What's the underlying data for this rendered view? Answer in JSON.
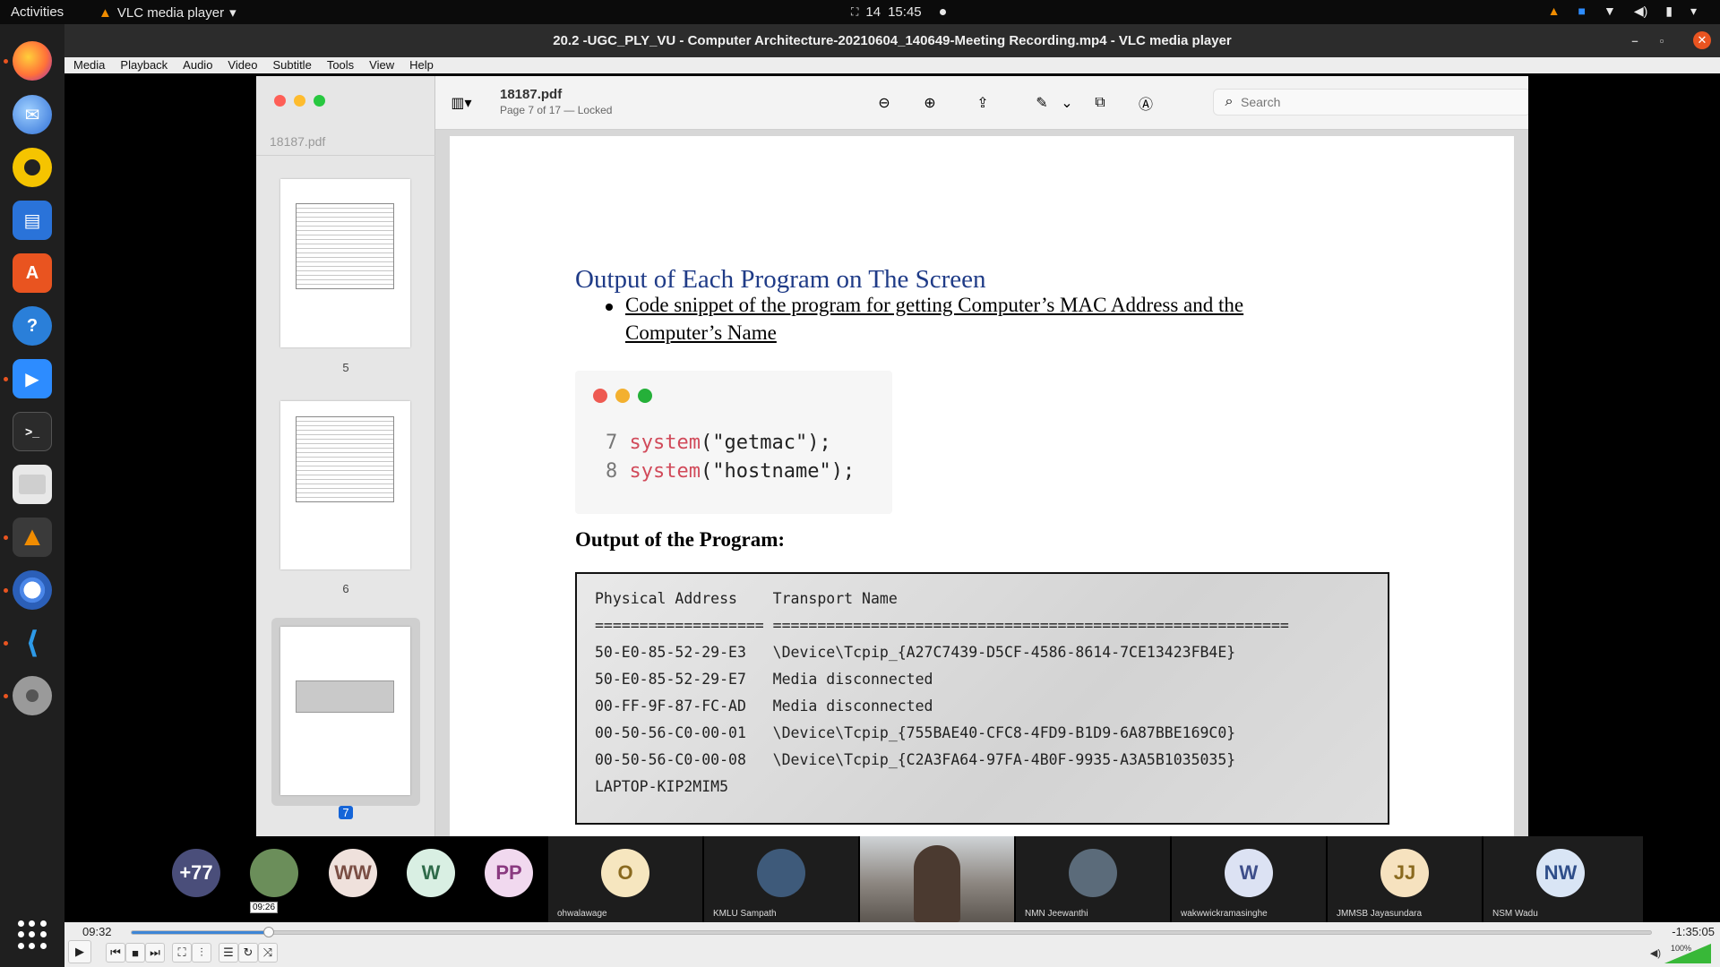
{
  "topbar": {
    "activities": "Activities",
    "app_name": "VLC media player",
    "date": "14",
    "time": "15:45"
  },
  "vlc": {
    "window_title": "20.2 -UGC_PLY_VU - Computer Architecture-20210604_140649-Meeting Recording.mp4 - VLC media player",
    "menu": [
      "Media",
      "Playback",
      "Audio",
      "Video",
      "Subtitle",
      "Tools",
      "View",
      "Help"
    ],
    "time_elapsed": "09:32",
    "time_remaining": "-1:35:05",
    "hover_time": "09:26",
    "progress": 0.09,
    "volume_label": "100%",
    "volume_level": 1.0
  },
  "preview": {
    "sidebar_filename": "18187.pdf",
    "thumbnails": [
      {
        "page": "5"
      },
      {
        "page": "6"
      },
      {
        "page": "7",
        "selected": true
      }
    ],
    "doc_title": "18187.pdf",
    "doc_subtitle": "Page 7 of 17 — Locked",
    "search_placeholder": "Search"
  },
  "document": {
    "heading": "Output of Each Program on The Screen",
    "bullet": "Code snippet of the program for getting Computer’s MAC Address and the Computer’s Name",
    "code": [
      {
        "line": "7",
        "fn": "system",
        "arg": "\"getmac\""
      },
      {
        "line": "8",
        "fn": "system",
        "arg": "\"hostname\""
      }
    ],
    "output_heading": "Output of the Program:",
    "output_lines": [
      "Physical Address    Transport Name",
      "=================== ==========================================================",
      "50-E0-85-52-29-E3   \\Device\\Tcpip_{A27C7439-D5CF-4586-8614-7CE13423FB4E}",
      "50-E0-85-52-29-E7   Media disconnected",
      "00-FF-9F-87-FC-AD   Media disconnected",
      "00-50-56-C0-00-01   \\Device\\Tcpip_{755BAE40-CFC8-4FD9-B1D9-6A87BBE169C0}",
      "00-50-56-C0-00-08   \\Device\\Tcpip_{C2A3FA64-97FA-4B0F-9935-A3A5B1035035}",
      "LAPTOP-KIP2MIM5"
    ]
  },
  "participants": [
    {
      "initials": "+77",
      "name": "",
      "color": "#4a4e7a",
      "text_color": "#ffffff"
    },
    {
      "initials": "",
      "name": "",
      "color": "#6b8e5a",
      "text_color": "#ffffff",
      "photo": true
    },
    {
      "initials": "WW",
      "name": "",
      "color": "#efe1dc",
      "text_color": "#7a4e44"
    },
    {
      "initials": "W",
      "name": "",
      "color": "#d9efe3",
      "text_color": "#2f6b4a"
    },
    {
      "initials": "PP",
      "name": "",
      "color": "#f1d9ef",
      "text_color": "#8a3a80"
    },
    {
      "initials": "O",
      "name": "ohwalawage",
      "color": "#f6e6bf",
      "text_color": "#8a6a1f"
    },
    {
      "initials": "",
      "name": "KMLU Sampath",
      "color": "#3e5a7a",
      "text_color": "#ffffff",
      "photo": true
    },
    {
      "initials": "",
      "name": "",
      "color": "#7a6e64",
      "text_color": "#ffffff",
      "photo": true,
      "video": true
    },
    {
      "initials": "",
      "name": "NMN Jeewanthi",
      "color": "#5b6b7a",
      "text_color": "#ffffff",
      "photo": true
    },
    {
      "initials": "W",
      "name": "wakwwickramasinghe",
      "color": "#dce2f3",
      "text_color": "#3e4e8a"
    },
    {
      "initials": "JJ",
      "name": "JMMSB Jayasundara",
      "color": "#f6e2bf",
      "text_color": "#8a6a1f"
    },
    {
      "initials": "NW",
      "name": "NSM Wadu",
      "color": "#d9e5f5",
      "text_color": "#2f4e8a"
    }
  ]
}
